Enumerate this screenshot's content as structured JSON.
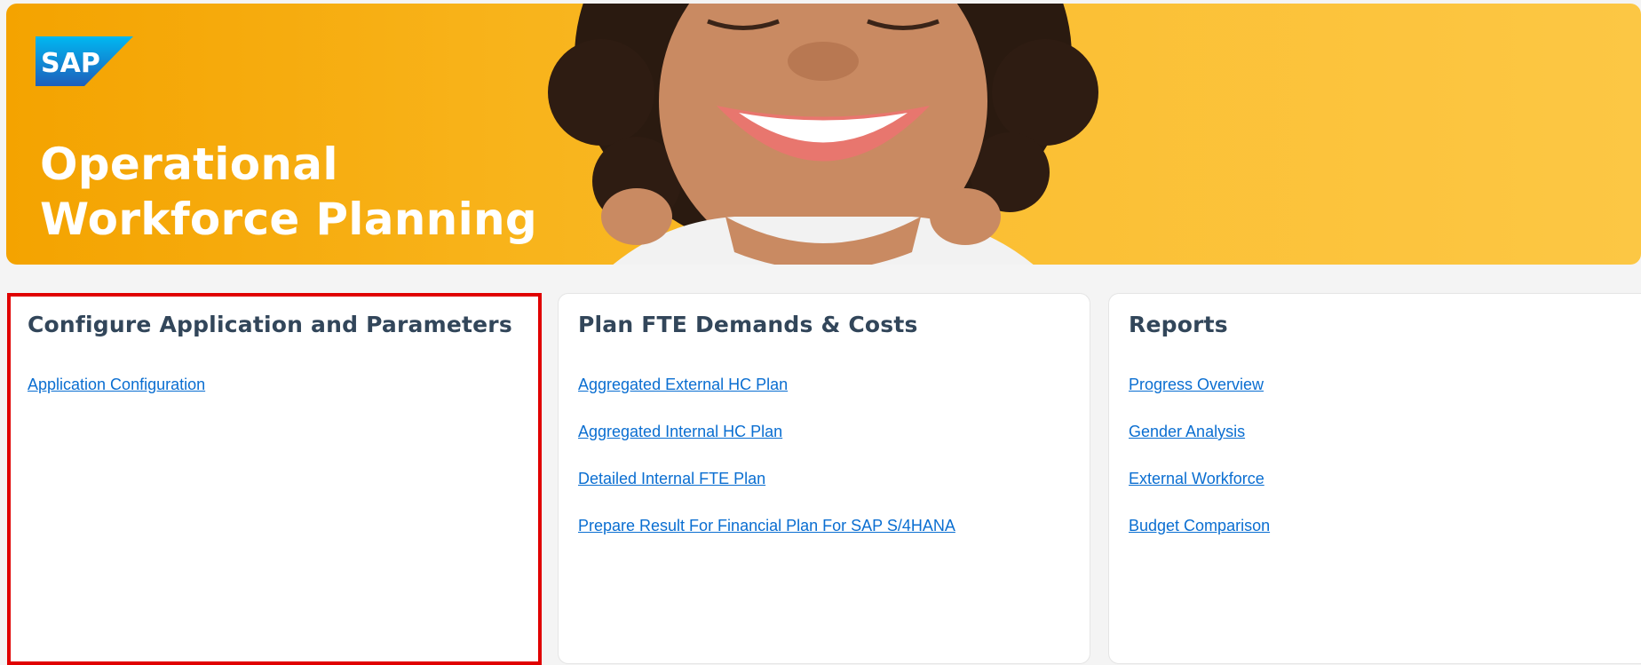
{
  "banner": {
    "logo_text": "SAP",
    "title_line1": "Operational",
    "title_line2": "Workforce Planning"
  },
  "cards": [
    {
      "title": "Configure Application and Parameters",
      "links": [
        "Application Configuration"
      ]
    },
    {
      "title": "Plan FTE Demands & Costs",
      "links": [
        "Aggregated External HC Plan",
        "Aggregated Internal HC Plan",
        "Detailed Internal FTE Plan",
        "Prepare Result For Financial Plan For SAP S/4HANA"
      ]
    },
    {
      "title": "Reports",
      "links": [
        "Progress Overview",
        "Gender Analysis",
        "External Workforce",
        "Budget Comparison"
      ]
    }
  ],
  "colors": {
    "banner": "#f8b31a",
    "link": "#0a6ed1",
    "heading": "#32465a",
    "highlight_border": "#e00000"
  }
}
